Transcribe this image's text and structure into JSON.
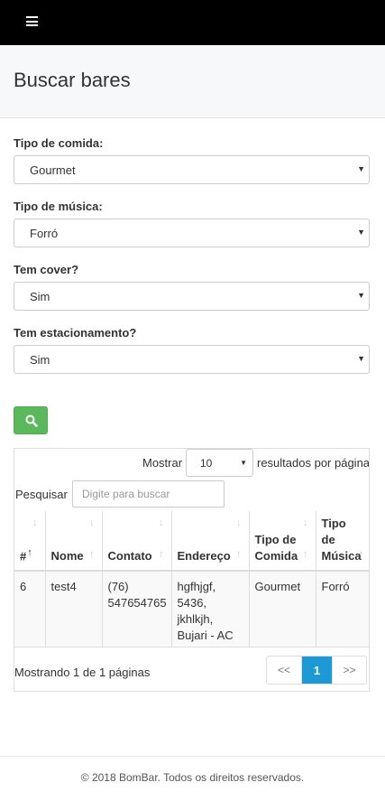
{
  "navbar": {
    "menu_icon": "hamburger-menu-icon"
  },
  "header": {
    "title": "Buscar bares"
  },
  "form": {
    "food_type": {
      "label": "Tipo de comida:",
      "value": "Gourmet"
    },
    "music_type": {
      "label": "Tipo de música:",
      "value": "Forró"
    },
    "cover": {
      "label": "Tem cover?",
      "value": "Sim"
    },
    "parking": {
      "label": "Tem estacionamento?",
      "value": "Sim"
    },
    "search_button_icon": "search-icon",
    "button_color": "#5cb85c"
  },
  "table": {
    "show_label": "Mostrar",
    "page_length": "10",
    "results_label": "resultados por página",
    "search_label": "Pesquisar",
    "search_placeholder": "Digite para buscar",
    "columns": [
      "#",
      "Nome",
      "Contato",
      "Endereço",
      "Tipo de Comida",
      "Tipo de Música"
    ],
    "column_lines": {
      "contato": "Contato",
      "endereco": "Endereço",
      "comida": [
        "Tipo de",
        "Comida"
      ],
      "musica": [
        "Tipo",
        "de",
        "Música"
      ]
    },
    "rows": [
      {
        "id": "6",
        "nome": "test4",
        "contato": [
          "(76)",
          "547654765"
        ],
        "endereco": [
          "hgfhjgf,",
          "5436,",
          "jkhlkjh,",
          "Bujari - AC"
        ],
        "comida": "Gourmet",
        "musica": "Forró"
      }
    ],
    "info": "Mostrando 1 de 1 páginas",
    "pagination": {
      "prev": "<<",
      "current": "1",
      "next": ">>"
    },
    "accent_color": "#1d9ad6"
  },
  "footer": {
    "text": "© 2018 BomBar. Todos os direitos reservados."
  }
}
